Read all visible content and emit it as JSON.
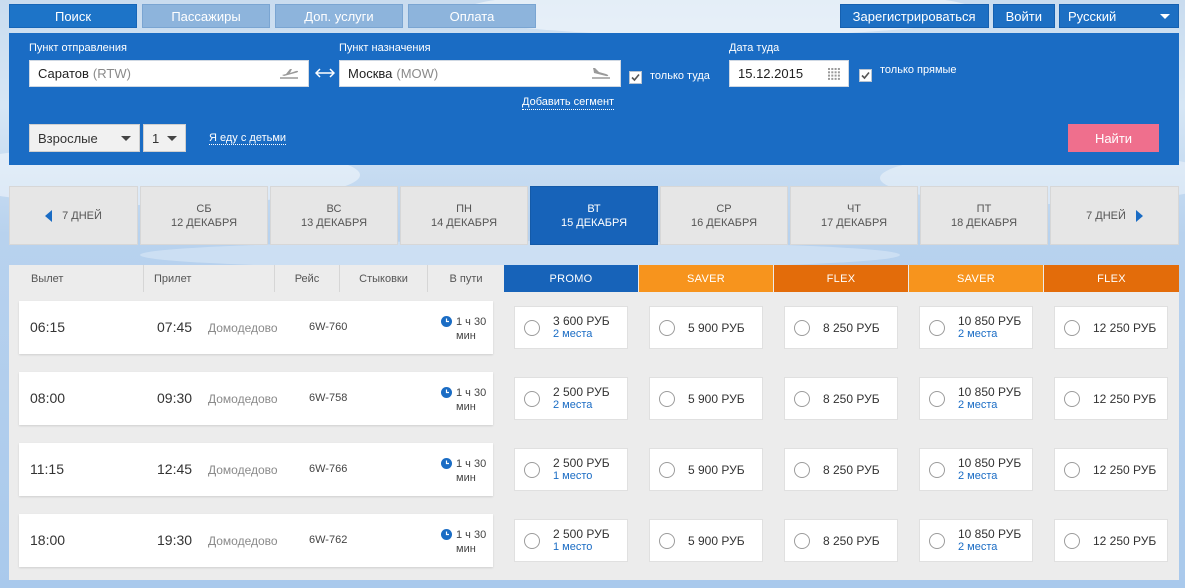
{
  "topnav": {
    "tabs": [
      {
        "label": "Поиск",
        "active": true
      },
      {
        "label": "Пассажиры",
        "active": false
      },
      {
        "label": "Доп. услуги",
        "active": false
      },
      {
        "label": "Оплата",
        "active": false
      }
    ],
    "register": "Зарегистрироваться",
    "login": "Войти",
    "language": "Русский"
  },
  "search": {
    "from_label": "Пункт отправления",
    "from_city": "Саратов",
    "from_code": "(RTW)",
    "to_label": "Пункт назначения",
    "to_city": "Москва",
    "to_code": "(MOW)",
    "oneway_label": "только туда",
    "oneway_checked": true,
    "date_label": "Дата туда",
    "date_value": "15.12.2015",
    "direct_label": "только прямые",
    "direct_checked": true,
    "add_segment": "Добавить сегмент",
    "pax_type": "Взрослые",
    "pax_count": "1",
    "kids_link": "Я еду с детьми",
    "find_button": "Найти"
  },
  "dates": {
    "prev": "7 ДНЕЙ",
    "next": "7 ДНЕЙ",
    "days": [
      {
        "dow": "СБ",
        "date": "12 ДЕКАБРЯ",
        "active": false
      },
      {
        "dow": "ВС",
        "date": "13 ДЕКАБРЯ",
        "active": false
      },
      {
        "dow": "ПН",
        "date": "14 ДЕКАБРЯ",
        "active": false
      },
      {
        "dow": "ВТ",
        "date": "15 ДЕКАБРЯ",
        "active": true
      },
      {
        "dow": "СР",
        "date": "16 ДЕКАБРЯ",
        "active": false
      },
      {
        "dow": "ЧТ",
        "date": "17 ДЕКАБРЯ",
        "active": false
      },
      {
        "dow": "ПТ",
        "date": "18 ДЕКАБРЯ",
        "active": false
      }
    ]
  },
  "table": {
    "headers": {
      "departure": "Вылет",
      "arrival": "Прилет",
      "flight": "Рейс",
      "connections": "Стыковки",
      "duration": "В пути"
    },
    "fares": [
      {
        "name": "PROMO",
        "color": "#1763b9"
      },
      {
        "name": "SAVER",
        "color": "#f7941d"
      },
      {
        "name": "FLEX",
        "color": "#e36c0a"
      },
      {
        "name": "SAVER",
        "color": "#f7941d"
      },
      {
        "name": "FLEX",
        "color": "#e36c0a"
      }
    ],
    "rows": [
      {
        "dep": "06:15",
        "arr": "07:45",
        "airport": "Домодедово",
        "flight": "6W-760",
        "duration": "1 ч 30 мин",
        "prices": [
          {
            "price": "3 600 РУБ",
            "seats": "2 места"
          },
          {
            "price": "5 900 РУБ",
            "seats": ""
          },
          {
            "price": "8 250 РУБ",
            "seats": ""
          },
          {
            "price": "10 850 РУБ",
            "seats": "2 места"
          },
          {
            "price": "12 250 РУБ",
            "seats": ""
          }
        ]
      },
      {
        "dep": "08:00",
        "arr": "09:30",
        "airport": "Домодедово",
        "flight": "6W-758",
        "duration": "1 ч 30 мин",
        "prices": [
          {
            "price": "2 500 РУБ",
            "seats": "2 места"
          },
          {
            "price": "5 900 РУБ",
            "seats": ""
          },
          {
            "price": "8 250 РУБ",
            "seats": ""
          },
          {
            "price": "10 850 РУБ",
            "seats": "2 места"
          },
          {
            "price": "12 250 РУБ",
            "seats": ""
          }
        ]
      },
      {
        "dep": "11:15",
        "arr": "12:45",
        "airport": "Домодедово",
        "flight": "6W-766",
        "duration": "1 ч 30 мин",
        "prices": [
          {
            "price": "2 500 РУБ",
            "seats": "1 место"
          },
          {
            "price": "5 900 РУБ",
            "seats": ""
          },
          {
            "price": "8 250 РУБ",
            "seats": ""
          },
          {
            "price": "10 850 РУБ",
            "seats": "2 места"
          },
          {
            "price": "12 250 РУБ",
            "seats": ""
          }
        ]
      },
      {
        "dep": "18:00",
        "arr": "19:30",
        "airport": "Домодедово",
        "flight": "6W-762",
        "duration": "1 ч 30 мин",
        "prices": [
          {
            "price": "2 500 РУБ",
            "seats": "1 место"
          },
          {
            "price": "5 900 РУБ",
            "seats": ""
          },
          {
            "price": "8 250 РУБ",
            "seats": ""
          },
          {
            "price": "10 850 РУБ",
            "seats": "2 места"
          },
          {
            "price": "12 250 РУБ",
            "seats": ""
          }
        ]
      }
    ]
  }
}
